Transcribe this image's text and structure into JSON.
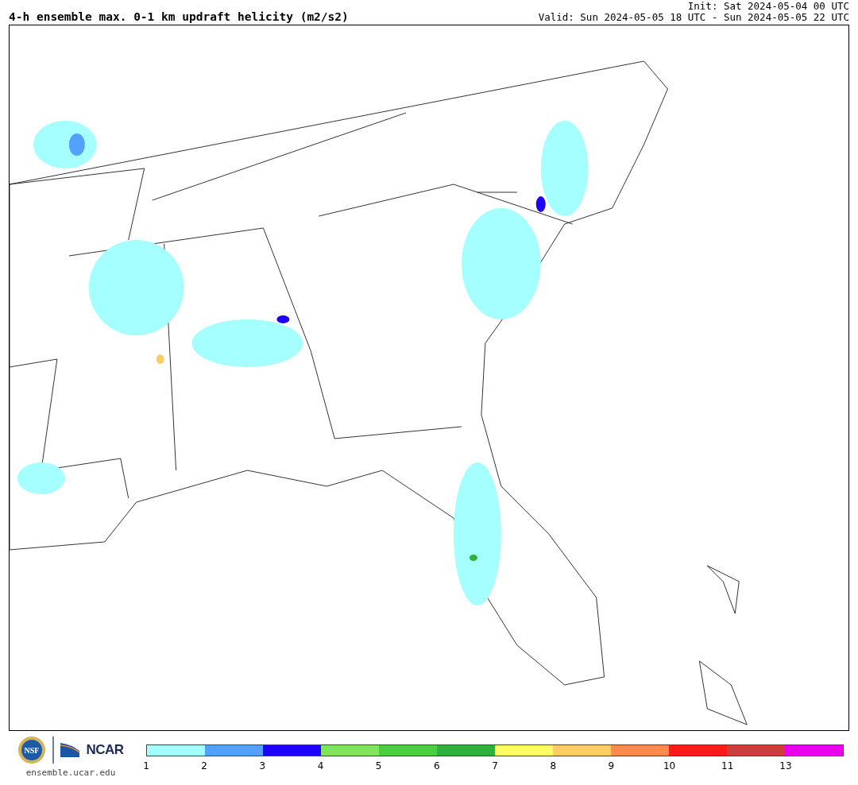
{
  "title": "4-h ensemble max. 0-1 km updraft helicity (m2/s2)",
  "init": "Init: Sat 2024-05-04 00 UTC",
  "valid": "Valid: Sun 2024-05-05 18 UTC - Sun 2024-05-05 22 UTC",
  "footer": {
    "logo_nsf": "NSF",
    "logo_ncar": "NCAR",
    "url": "ensemble.ucar.edu"
  },
  "legend": [
    {
      "label": "1",
      "color": "#a6ffff"
    },
    {
      "label": "2",
      "color": "#52a0ff"
    },
    {
      "label": "3",
      "color": "#1e00ff"
    },
    {
      "label": "4",
      "color": "#7ee55c"
    },
    {
      "label": "5",
      "color": "#4ccc41"
    },
    {
      "label": "6",
      "color": "#2fb03a"
    },
    {
      "label": "7",
      "color": "#ffff61"
    },
    {
      "label": "8",
      "color": "#ffcc66"
    },
    {
      "label": "9",
      "color": "#ff8a4e"
    },
    {
      "label": "10",
      "color": "#ff1a1a"
    },
    {
      "label": "11",
      "color": "#cc3e3e"
    },
    {
      "label": "13",
      "color": "#ea00ea"
    }
  ]
}
